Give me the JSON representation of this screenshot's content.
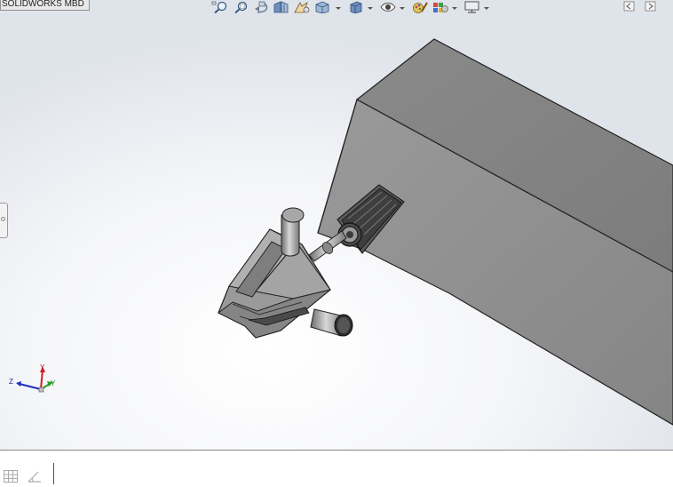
{
  "app": {
    "tab_label": "SOLIDWORKS MBD"
  },
  "toolbar": {
    "icons": [
      "zoom-to-fit-icon",
      "zoom-to-area-icon",
      "previous-view-icon",
      "section-view-icon",
      "dynamic-annotation-view-icon",
      "view-orientation-icon",
      "display-style-icon",
      "hide-show-items-icon",
      "edit-appearance-icon",
      "apply-scene-icon",
      "view-settings-icon"
    ]
  },
  "triad": {
    "x_label": "X",
    "y_label": "Y",
    "z_label": "Z"
  },
  "colors": {
    "viewport_top": "#dfe3ea",
    "viewport_center": "#ffffff",
    "block_front": "#8f8f8f",
    "block_top": "#848484",
    "block_side": "#7a7a7a",
    "part_gray": "#9c9c9c"
  }
}
